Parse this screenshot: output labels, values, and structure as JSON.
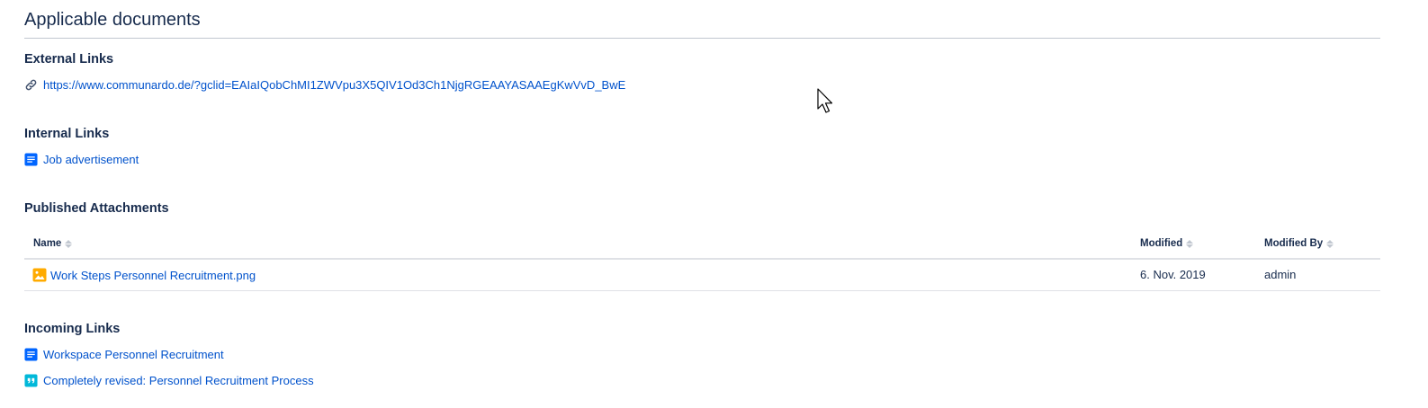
{
  "page": {
    "title": "Applicable documents"
  },
  "external_links": {
    "title": "External Links",
    "items": [
      {
        "icon": "link-icon",
        "label": "https://www.communardo.de/?gclid=EAIaIQobChMI1ZWVpu3X5QIV1Od3Ch1NjgRGEAAYASAAEgKwVvD_BwE"
      }
    ]
  },
  "internal_links": {
    "title": "Internal Links",
    "items": [
      {
        "icon": "page-icon",
        "label": "Job advertisement"
      }
    ]
  },
  "attachments": {
    "title": "Published Attachments",
    "columns": {
      "name": "Name",
      "modified": "Modified",
      "modified_by": "Modified By"
    },
    "rows": [
      {
        "icon": "image-icon",
        "name": "Work Steps Personnel Recruitment.png",
        "modified": "6. Nov. 2019",
        "modified_by": "admin"
      }
    ]
  },
  "incoming_links": {
    "title": "Incoming Links",
    "items": [
      {
        "icon": "page-icon",
        "label": "Workspace Personnel Recruitment"
      },
      {
        "icon": "blog-quote-icon",
        "label": "Completely revised: Personnel Recruitment Process"
      }
    ]
  },
  "colors": {
    "link": "#0052cc",
    "text": "#172b4d",
    "page_icon": "#0065ff",
    "image_icon": "#ffab00",
    "blog_icon": "#00b8d9"
  }
}
